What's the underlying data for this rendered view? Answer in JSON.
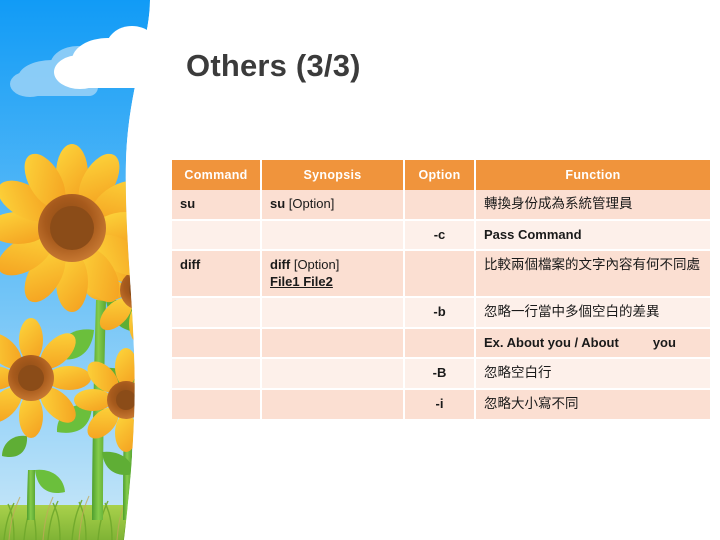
{
  "slide": {
    "title": "Others (3/3)",
    "background": {
      "name": "sunflower-sky-sidebar",
      "sky_top_color": "#1E9BF5",
      "sky_bottom_color": "#BFE3F7",
      "cloud_color": "#FFFFFF",
      "petal_color": "#F9C22B",
      "petal_shade_color": "#F5A623",
      "flower_center_color": "#B5651D",
      "stem_color": "#6BBE44",
      "leaf_color": "#57A83A",
      "grass_color": "#8CC63F",
      "page_color": "#FFFFFF"
    }
  },
  "table": {
    "accent_header_bg": "#F0943C",
    "header_text_color": "#FFFFFF",
    "row_shade_dark": "#FBDFD2",
    "row_shade_light": "#FDF0EA",
    "headers": [
      "Command",
      "Synopsis",
      "Option",
      "Function"
    ],
    "rows": [
      {
        "shade": "a",
        "command": "su",
        "synopsis_name": "su",
        "synopsis_option": " [Option]",
        "synopsis_files": "",
        "option": "",
        "function_cjk": "轉換身份成為系統管理員",
        "function_latin": "",
        "function_latin_tail": ""
      },
      {
        "shade": "b",
        "command": "",
        "synopsis_name": "",
        "synopsis_option": "",
        "synopsis_files": "",
        "option": "-c",
        "function_cjk": "",
        "function_latin": "Pass Command",
        "function_latin_tail": ""
      },
      {
        "shade": "a",
        "command": "diff",
        "synopsis_name": "diff",
        "synopsis_option": " [Option]",
        "synopsis_files": "File1 File2",
        "option": "",
        "function_cjk": "比較兩個檔案的文字內容有何不同處",
        "function_latin": "",
        "function_latin_tail": ""
      },
      {
        "shade": "b",
        "command": "",
        "synopsis_name": "",
        "synopsis_option": "",
        "synopsis_files": "",
        "option": "-b",
        "function_cjk": "忽略一行當中多個空白的差異",
        "function_latin": "",
        "function_latin_tail": ""
      },
      {
        "shade": "a",
        "command": "",
        "synopsis_name": "",
        "synopsis_option": "",
        "synopsis_files": "",
        "option": "",
        "function_cjk": "",
        "function_latin": "Ex. About you / About",
        "function_latin_tail": "you"
      },
      {
        "shade": "b",
        "command": "",
        "synopsis_name": "",
        "synopsis_option": "",
        "synopsis_files": "",
        "option": "-B",
        "function_cjk": "忽略空白行",
        "function_latin": "",
        "function_latin_tail": ""
      },
      {
        "shade": "a",
        "command": "",
        "synopsis_name": "",
        "synopsis_option": "",
        "synopsis_files": "",
        "option": "-i",
        "function_cjk": "忽略大小寫不同",
        "function_latin": "",
        "function_latin_tail": ""
      }
    ]
  }
}
